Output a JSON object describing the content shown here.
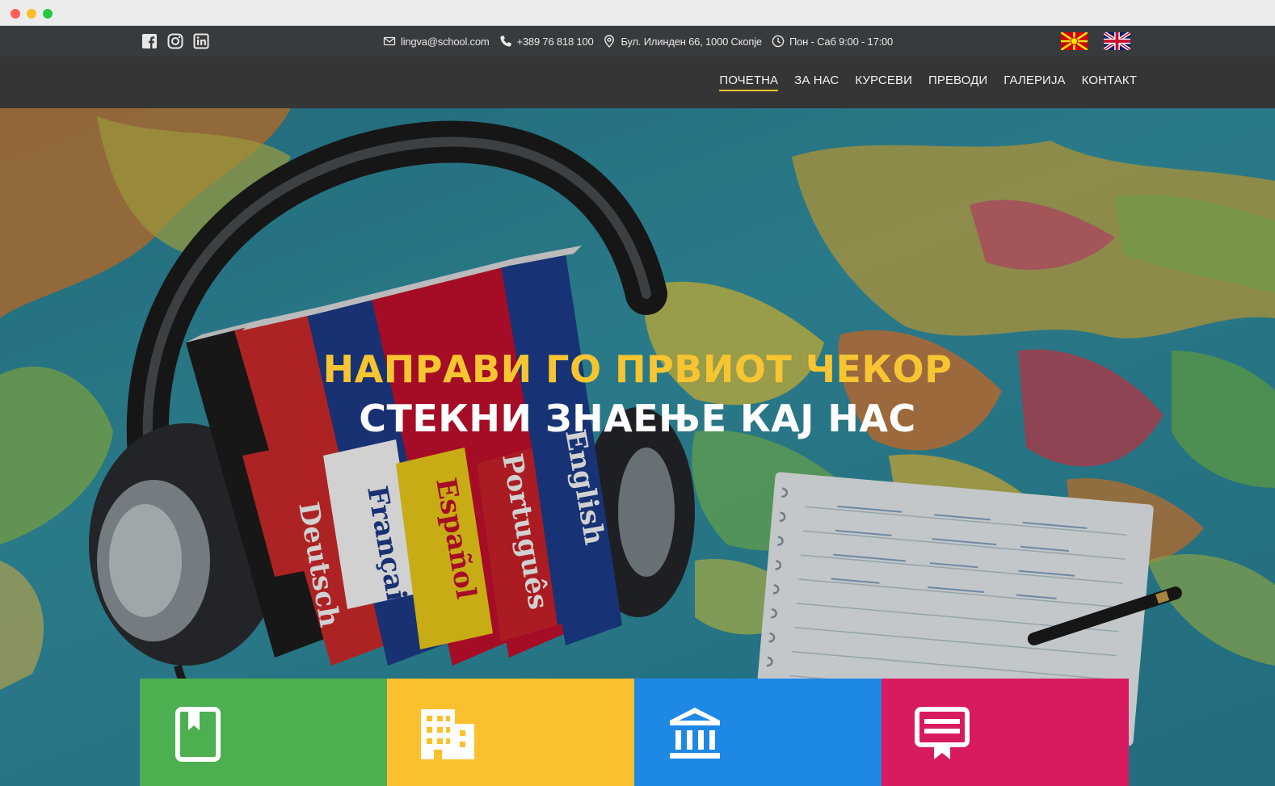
{
  "window": {
    "controls": [
      "close",
      "minimize",
      "maximize"
    ]
  },
  "topbar": {
    "socials": [
      {
        "name": "facebook-icon"
      },
      {
        "name": "instagram-icon"
      },
      {
        "name": "linkedin-icon"
      }
    ],
    "email": "lingva@school.com",
    "phone": "+389 76 818 100",
    "address": "Бул. Илинден 66, 1000 Скопје",
    "hours": "Пон - Саб 9:00 - 17:00",
    "languages": [
      {
        "code": "mk",
        "icon": "macedonia-flag-icon"
      },
      {
        "code": "en",
        "icon": "uk-flag-icon"
      }
    ]
  },
  "nav": {
    "items": [
      {
        "label": "ПОЧЕТНА",
        "active": true
      },
      {
        "label": "ЗА НАС"
      },
      {
        "label": "КУРСЕВИ"
      },
      {
        "label": "ПРЕВОДИ"
      },
      {
        "label": "ГАЛЕРИЈА"
      },
      {
        "label": "КОНТАКТ"
      }
    ]
  },
  "hero": {
    "line1": "НАПРАВИ ГО ПРВИОТ ЧЕКОР",
    "line2": "СТЕКНИ ЗНАЕЊЕ КАЈ НАС",
    "book_spines": [
      "Deutsch",
      "Français",
      "Español",
      "Português",
      "English"
    ]
  },
  "tiles": [
    {
      "icon": "book-icon",
      "color": "#4caf50"
    },
    {
      "icon": "building-icon",
      "color": "#fbc02d"
    },
    {
      "icon": "institution-icon",
      "color": "#1e88e5"
    },
    {
      "icon": "certificate-icon",
      "color": "#d81b60"
    }
  ],
  "colors": {
    "accent": "#f7c531",
    "topbar": "#383b3d",
    "navbar": "#353535"
  }
}
